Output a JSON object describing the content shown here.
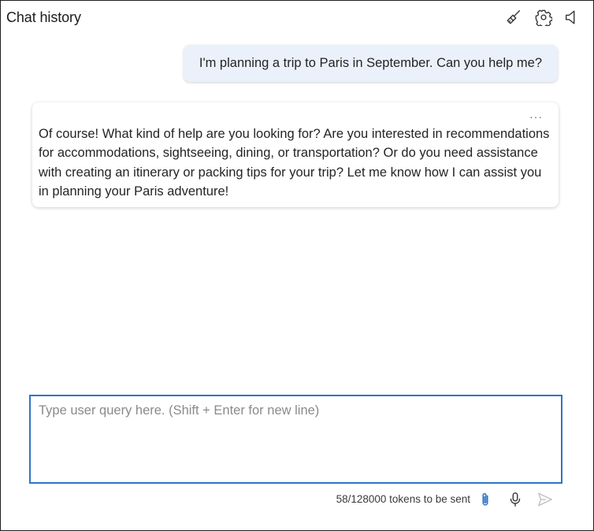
{
  "header": {
    "title": "Chat history",
    "icons": [
      "broom-icon",
      "settings-gear-icon",
      "speaker-icon"
    ]
  },
  "messages": [
    {
      "role": "user",
      "text": "I'm planning a trip to Paris in September. Can you help me?"
    },
    {
      "role": "assistant",
      "more_label": "···",
      "text": "Of course! What kind of help are you looking for? Are you interested in recommendations for accommodations, sightseeing, dining, or transportation? Or do you need assistance with creating an itinerary or packing tips for your trip? Let me know how I can assist you in planning your Paris adventure!"
    }
  ],
  "composer": {
    "placeholder": "Type user query here. (Shift + Enter for new line)",
    "value": "",
    "token_status": "58/128000 tokens to be sent",
    "icons": [
      "paperclip-icon",
      "microphone-icon",
      "send-icon"
    ]
  },
  "colors": {
    "accent": "#2f74c8",
    "user_bubble": "#eaf1fb",
    "send_disabled": "#bfbfbf"
  }
}
